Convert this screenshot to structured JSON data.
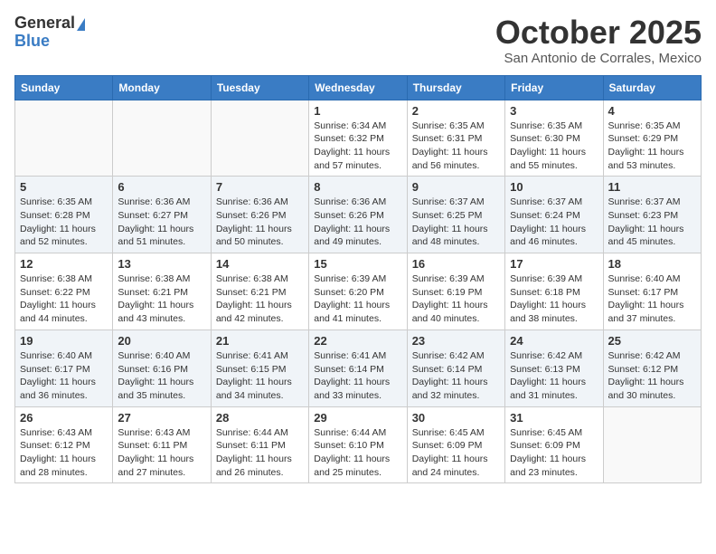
{
  "header": {
    "logo_general": "General",
    "logo_blue": "Blue",
    "month": "October 2025",
    "location": "San Antonio de Corrales, Mexico"
  },
  "weekdays": [
    "Sunday",
    "Monday",
    "Tuesday",
    "Wednesday",
    "Thursday",
    "Friday",
    "Saturday"
  ],
  "weeks": [
    [
      {
        "day": "",
        "info": ""
      },
      {
        "day": "",
        "info": ""
      },
      {
        "day": "",
        "info": ""
      },
      {
        "day": "1",
        "info": "Sunrise: 6:34 AM\nSunset: 6:32 PM\nDaylight: 11 hours\nand 57 minutes."
      },
      {
        "day": "2",
        "info": "Sunrise: 6:35 AM\nSunset: 6:31 PM\nDaylight: 11 hours\nand 56 minutes."
      },
      {
        "day": "3",
        "info": "Sunrise: 6:35 AM\nSunset: 6:30 PM\nDaylight: 11 hours\nand 55 minutes."
      },
      {
        "day": "4",
        "info": "Sunrise: 6:35 AM\nSunset: 6:29 PM\nDaylight: 11 hours\nand 53 minutes."
      }
    ],
    [
      {
        "day": "5",
        "info": "Sunrise: 6:35 AM\nSunset: 6:28 PM\nDaylight: 11 hours\nand 52 minutes."
      },
      {
        "day": "6",
        "info": "Sunrise: 6:36 AM\nSunset: 6:27 PM\nDaylight: 11 hours\nand 51 minutes."
      },
      {
        "day": "7",
        "info": "Sunrise: 6:36 AM\nSunset: 6:26 PM\nDaylight: 11 hours\nand 50 minutes."
      },
      {
        "day": "8",
        "info": "Sunrise: 6:36 AM\nSunset: 6:26 PM\nDaylight: 11 hours\nand 49 minutes."
      },
      {
        "day": "9",
        "info": "Sunrise: 6:37 AM\nSunset: 6:25 PM\nDaylight: 11 hours\nand 48 minutes."
      },
      {
        "day": "10",
        "info": "Sunrise: 6:37 AM\nSunset: 6:24 PM\nDaylight: 11 hours\nand 46 minutes."
      },
      {
        "day": "11",
        "info": "Sunrise: 6:37 AM\nSunset: 6:23 PM\nDaylight: 11 hours\nand 45 minutes."
      }
    ],
    [
      {
        "day": "12",
        "info": "Sunrise: 6:38 AM\nSunset: 6:22 PM\nDaylight: 11 hours\nand 44 minutes."
      },
      {
        "day": "13",
        "info": "Sunrise: 6:38 AM\nSunset: 6:21 PM\nDaylight: 11 hours\nand 43 minutes."
      },
      {
        "day": "14",
        "info": "Sunrise: 6:38 AM\nSunset: 6:21 PM\nDaylight: 11 hours\nand 42 minutes."
      },
      {
        "day": "15",
        "info": "Sunrise: 6:39 AM\nSunset: 6:20 PM\nDaylight: 11 hours\nand 41 minutes."
      },
      {
        "day": "16",
        "info": "Sunrise: 6:39 AM\nSunset: 6:19 PM\nDaylight: 11 hours\nand 40 minutes."
      },
      {
        "day": "17",
        "info": "Sunrise: 6:39 AM\nSunset: 6:18 PM\nDaylight: 11 hours\nand 38 minutes."
      },
      {
        "day": "18",
        "info": "Sunrise: 6:40 AM\nSunset: 6:17 PM\nDaylight: 11 hours\nand 37 minutes."
      }
    ],
    [
      {
        "day": "19",
        "info": "Sunrise: 6:40 AM\nSunset: 6:17 PM\nDaylight: 11 hours\nand 36 minutes."
      },
      {
        "day": "20",
        "info": "Sunrise: 6:40 AM\nSunset: 6:16 PM\nDaylight: 11 hours\nand 35 minutes."
      },
      {
        "day": "21",
        "info": "Sunrise: 6:41 AM\nSunset: 6:15 PM\nDaylight: 11 hours\nand 34 minutes."
      },
      {
        "day": "22",
        "info": "Sunrise: 6:41 AM\nSunset: 6:14 PM\nDaylight: 11 hours\nand 33 minutes."
      },
      {
        "day": "23",
        "info": "Sunrise: 6:42 AM\nSunset: 6:14 PM\nDaylight: 11 hours\nand 32 minutes."
      },
      {
        "day": "24",
        "info": "Sunrise: 6:42 AM\nSunset: 6:13 PM\nDaylight: 11 hours\nand 31 minutes."
      },
      {
        "day": "25",
        "info": "Sunrise: 6:42 AM\nSunset: 6:12 PM\nDaylight: 11 hours\nand 30 minutes."
      }
    ],
    [
      {
        "day": "26",
        "info": "Sunrise: 6:43 AM\nSunset: 6:12 PM\nDaylight: 11 hours\nand 28 minutes."
      },
      {
        "day": "27",
        "info": "Sunrise: 6:43 AM\nSunset: 6:11 PM\nDaylight: 11 hours\nand 27 minutes."
      },
      {
        "day": "28",
        "info": "Sunrise: 6:44 AM\nSunset: 6:11 PM\nDaylight: 11 hours\nand 26 minutes."
      },
      {
        "day": "29",
        "info": "Sunrise: 6:44 AM\nSunset: 6:10 PM\nDaylight: 11 hours\nand 25 minutes."
      },
      {
        "day": "30",
        "info": "Sunrise: 6:45 AM\nSunset: 6:09 PM\nDaylight: 11 hours\nand 24 minutes."
      },
      {
        "day": "31",
        "info": "Sunrise: 6:45 AM\nSunset: 6:09 PM\nDaylight: 11 hours\nand 23 minutes."
      },
      {
        "day": "",
        "info": ""
      }
    ]
  ]
}
